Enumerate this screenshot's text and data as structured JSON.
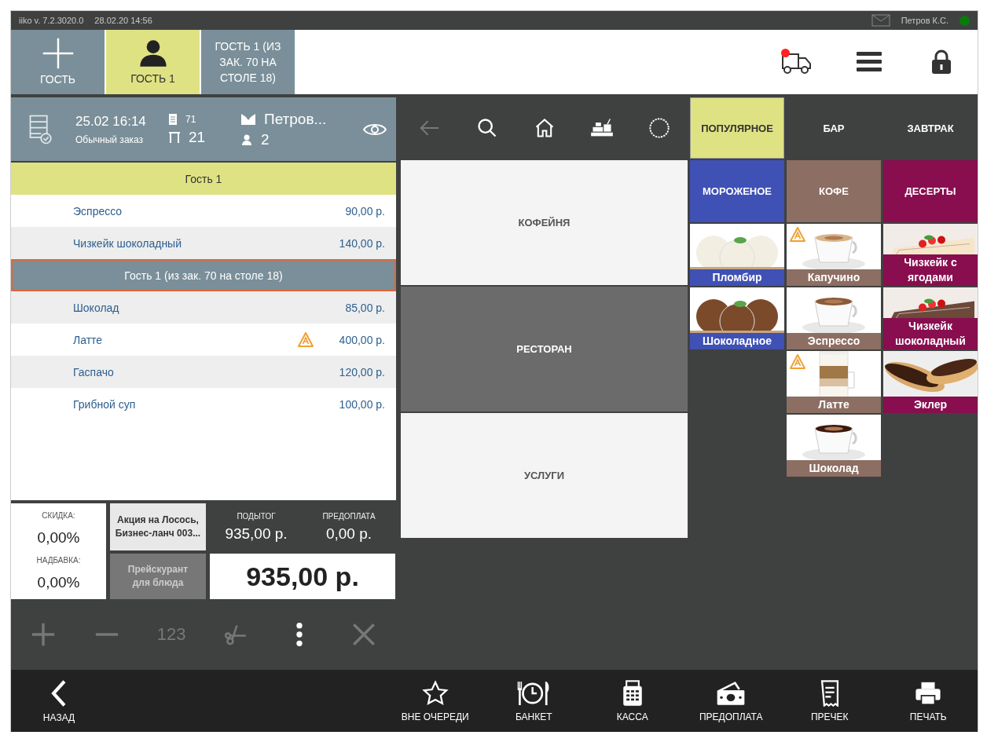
{
  "title_bar": {
    "version": "iiko v. 7.2.3020.0",
    "datetime": "28.02.20 14:56",
    "user": "Петров К.С.",
    "online": true
  },
  "guest_tabs": [
    {
      "kind": "add",
      "label": "ГОСТЬ",
      "selected": false
    },
    {
      "kind": "guest",
      "label": "ГОСТЬ 1",
      "selected": true
    },
    {
      "kind": "text",
      "label": "ГОСТЬ 1 (ИЗ ЗАК. 70 НА СТОЛЕ 18)",
      "selected": false
    }
  ],
  "header_actions": [
    {
      "kind": "delivery"
    },
    {
      "kind": "menu"
    },
    {
      "kind": "lock"
    }
  ],
  "delivery_notification": true,
  "order": {
    "opened": "25.02 16:14",
    "type": "Обычный заказ",
    "number": "71",
    "table": "21",
    "waiter": "Петров...",
    "guests": "2",
    "lines": [
      {
        "kind": "guest",
        "label": "Гость 1",
        "current": true,
        "selected": false
      },
      {
        "kind": "item",
        "name": "Эспрессо",
        "price": "90,00 р.",
        "warning": false
      },
      {
        "kind": "item",
        "name": "Чизкейк шоколадный",
        "price": "140,00 р.",
        "warning": false
      },
      {
        "kind": "guest",
        "label": "Гость 1 (из зак. 70 на столе 18)",
        "current": false,
        "selected": true
      },
      {
        "kind": "item",
        "name": "Шоколад",
        "price": "85,00 р.",
        "warning": false
      },
      {
        "kind": "item",
        "name": "Латте",
        "price": "400,00 р.",
        "warning": true
      },
      {
        "kind": "item",
        "name": "Гаспачо",
        "price": "120,00 р.",
        "warning": false
      },
      {
        "kind": "item",
        "name": "Грибной суп",
        "price": "100,00 р.",
        "warning": false
      }
    ]
  },
  "totals": {
    "discount_label": "СКИДКА:",
    "discount": "0,00%",
    "markup_label": "НАДБАВКА:",
    "markup": "0,00%",
    "promotions": "Акция на Лосось, Бизнес-ланч 003...",
    "price_list": "Прейскурант для блюда",
    "price_list_disabled": true,
    "subtotal_label": "ПОДЫТОГ",
    "subtotal": "935,00 р.",
    "prepayment_label": "ПРЕДОПЛАТА",
    "prepayment": "0,00 р.",
    "total": "935,00 р."
  },
  "order_actions": [
    {
      "kind": "plus",
      "disabled": true
    },
    {
      "kind": "minus",
      "disabled": true
    },
    {
      "kind": "quantity",
      "label": "123",
      "disabled": true
    },
    {
      "kind": "split",
      "disabled": true
    },
    {
      "kind": "more",
      "disabled": false
    },
    {
      "kind": "delete",
      "disabled": true
    }
  ],
  "menu_nav": [
    {
      "kind": "back",
      "disabled": true
    },
    {
      "kind": "search",
      "disabled": false
    },
    {
      "kind": "home",
      "disabled": false
    },
    {
      "kind": "register",
      "disabled": false
    },
    {
      "kind": "circle",
      "disabled": false
    }
  ],
  "sections": [
    {
      "label": "КОФЕЙНЯ",
      "selected": false
    },
    {
      "label": "РЕСТОРАН",
      "selected": true
    },
    {
      "label": "УСЛУГИ",
      "selected": false
    }
  ],
  "menu_tabs": [
    {
      "label": "ПОПУЛЯРНОЕ",
      "selected": true
    },
    {
      "label": "БАР",
      "selected": false
    },
    {
      "label": "ЗАВТРАК",
      "selected": false
    }
  ],
  "categories": [
    {
      "label": "МОРОЖЕНОЕ",
      "color": "#3f51b5",
      "products": [
        {
          "name": "Пломбир",
          "warning": false,
          "kind": "picture"
        },
        {
          "name": "Шоколадное",
          "warning": false,
          "kind": "picture"
        }
      ]
    },
    {
      "label": "КОФЕ",
      "color": "#8d6e63",
      "products": [
        {
          "name": "Капучино",
          "warning": true,
          "kind": "picture"
        },
        {
          "name": "Эспрессо",
          "warning": false,
          "kind": "picture"
        },
        {
          "name": "Латте",
          "warning": true,
          "kind": "picture"
        },
        {
          "name": "Шоколад",
          "warning": false,
          "kind": "picture"
        }
      ]
    },
    {
      "label": "ДЕСЕРТЫ",
      "color": "#880e4f",
      "products": [
        {
          "name": "Чизкейк с ягодами",
          "warning": false,
          "kind": "picture"
        },
        {
          "name": "Чизкейк шоколадный",
          "warning": false,
          "kind": "picture"
        },
        {
          "name": "Эклер",
          "warning": false,
          "kind": "picture"
        }
      ]
    }
  ],
  "bottom_bar": {
    "back": "НАЗАД",
    "actions": [
      {
        "kind": "star",
        "label": "ВНЕ ОЧЕРЕДИ"
      },
      {
        "kind": "banquet",
        "label": "БАНКЕТ"
      },
      {
        "kind": "calculator",
        "label": "КАССА"
      },
      {
        "kind": "money",
        "label": "ПРЕДОПЛАТА"
      },
      {
        "kind": "receipt",
        "label": "ПРЕЧЕК"
      },
      {
        "kind": "printer",
        "label": "ПЕЧАТЬ"
      }
    ]
  }
}
